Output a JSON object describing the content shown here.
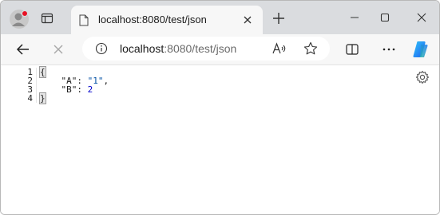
{
  "tab": {
    "title": "localhost:8080/test/json",
    "close_icon": "close-icon",
    "favicon_icon": "page-icon"
  },
  "omnibox": {
    "url_host": "localhost",
    "url_rest": ":8080/test/json"
  },
  "json_viewer": {
    "line_numbers": [
      "1",
      "2",
      "3",
      "4"
    ],
    "open_brace": "{",
    "close_brace": "}",
    "entries": [
      {
        "key": "\"A\"",
        "colon": ": ",
        "value": "\"1\"",
        "trail": ","
      },
      {
        "key": "\"B\"",
        "colon": ": ",
        "value": "2",
        "trail": ""
      }
    ]
  },
  "colors": {
    "tabstrip": "#dadcdf",
    "toolbar": "#f7f7f7",
    "string_value": "#0451a5",
    "number_value": "#0000cc",
    "copilot_blue": "#1c7cf3",
    "profile_badge": "#e81123"
  }
}
